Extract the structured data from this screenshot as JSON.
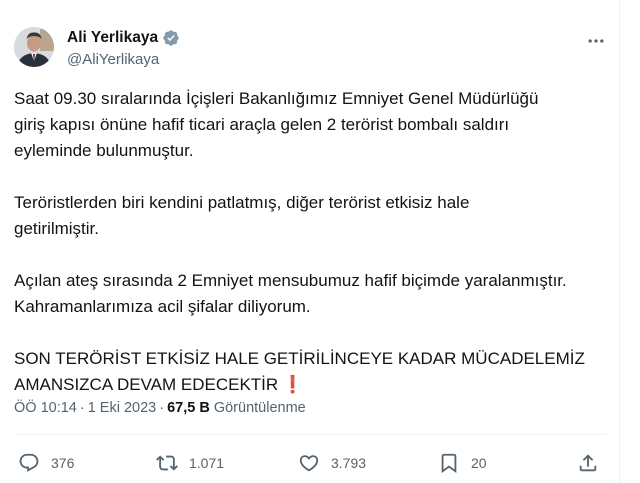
{
  "author": {
    "name": "Ali Yerlikaya",
    "handle": "@AliYerlikaya",
    "verified_color": "#829aab"
  },
  "tweet": {
    "paragraphs": [
      "Saat 09.30 sıralarında İçişleri Bakanlığımız Emniyet Genel Müdürlüğü\ngiriş kapısı önüne hafif ticari araçla gelen 2 terörist bombalı saldırı\neyleminde bulunmuştur.",
      "Teröristlerden biri kendini patlatmış, diğer terörist etkisiz hale\ngetirilmiştir.",
      "Açılan ateş sırasında 2 Emniyet mensubumuz hafif biçimde yaralanmıştır.\nKahramanlarımıza acil şifalar diliyorum.",
      "SON TERÖRİST ETKİSİZ HALE GETİRİLİNCEYE KADAR MÜCADELEMİZ\nAMANSIZCA DEVAM EDECEKTİR"
    ],
    "emoji": "❗"
  },
  "meta": {
    "time": "ÖÖ 10:14",
    "separator": "·",
    "date": "1 Eki 2023",
    "views_count": "67,5 B",
    "views_label": "Görüntülenme"
  },
  "actions": {
    "replies": "376",
    "retweets": "1.071",
    "likes": "3.793",
    "bookmarks": "20"
  },
  "colors": {
    "text": "#0f1419",
    "secondary": "#536471",
    "divider": "#eff3f4",
    "emoji_red": "#dd2e44"
  }
}
